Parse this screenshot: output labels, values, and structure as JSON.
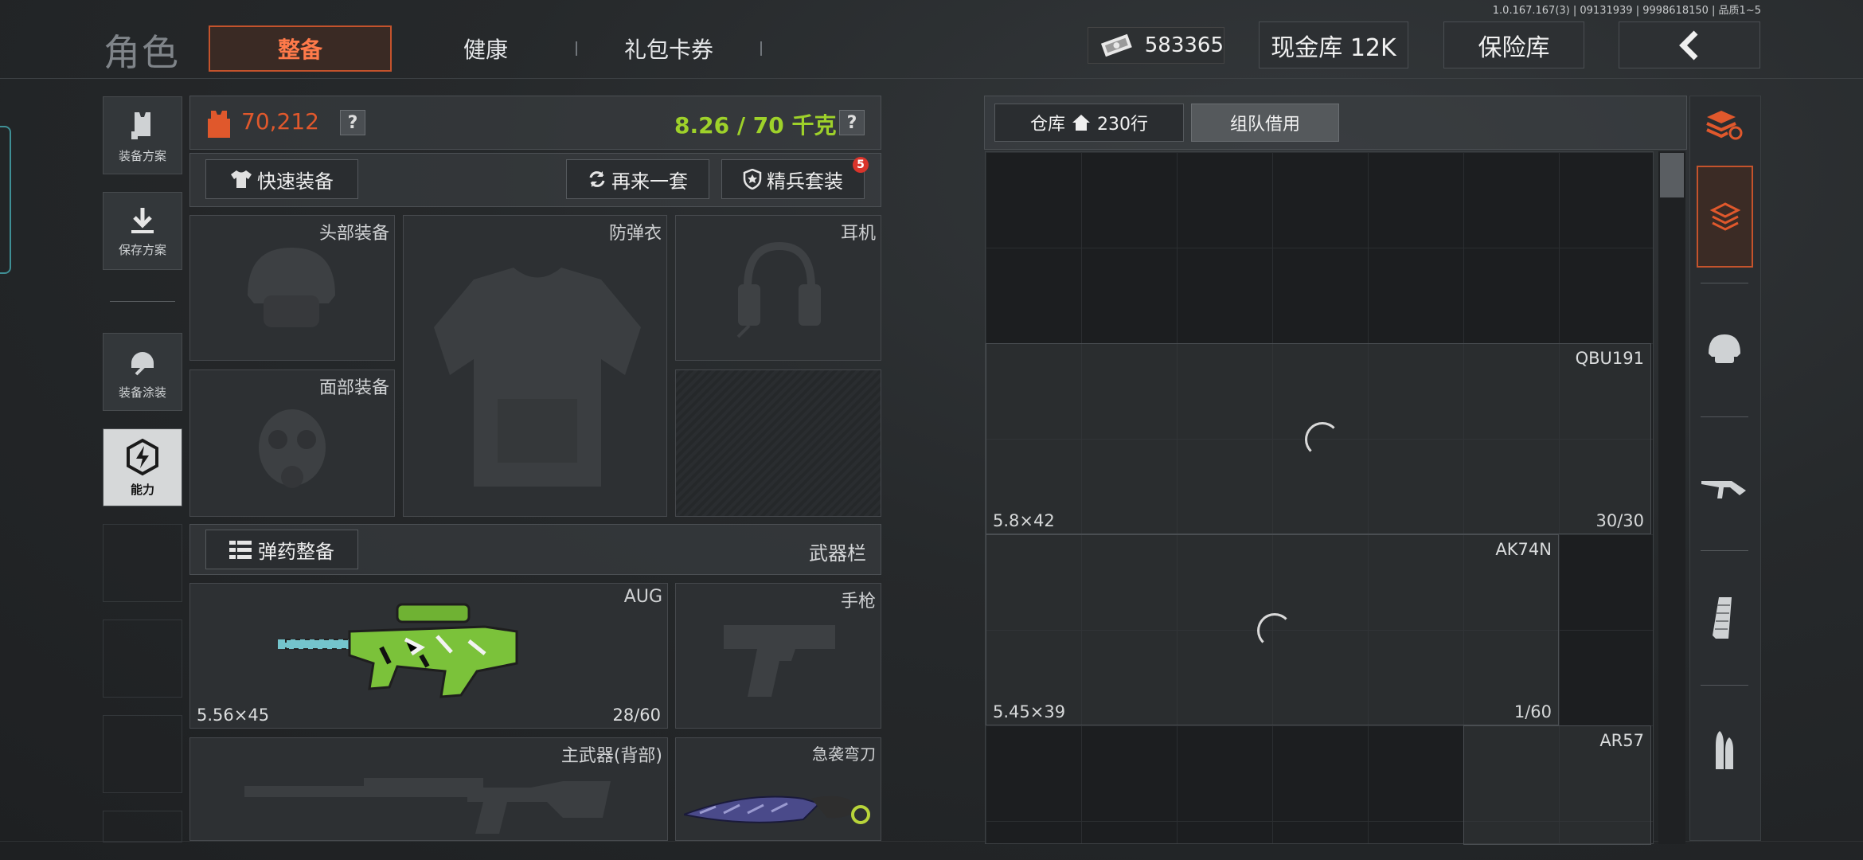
{
  "header": {
    "brand": "角色",
    "tabs": [
      "整备",
      "健康",
      "礼包卡券"
    ],
    "money_value": "583365",
    "cash_vault": "现金库 12K",
    "safe_vault": "保险库",
    "version": "1.0.167.167(3) | 09131939 | 9998618150 | 品质1~5"
  },
  "left_rail": {
    "items": [
      "装备方案",
      "保存方案",
      "装备涂装",
      "能力"
    ]
  },
  "equipment": {
    "value": "70,212",
    "weight": "8.26 / 70 千克",
    "quick_equip": "快速装备",
    "again": "再来一套",
    "elite_set": "精兵套装",
    "elite_badge": "5",
    "slots": {
      "head": "头部装备",
      "vest": "防弹衣",
      "earphone": "耳机",
      "face": "面部装备"
    },
    "ammo_btn": "弹药整备",
    "weapon_bar": "武器栏",
    "primary": {
      "name": "AUG",
      "caliber": "5.56×45",
      "ammo": "28/60"
    },
    "pistol": "手枪",
    "back_weapon": "主武器(背部)",
    "knife": "急袭弯刀"
  },
  "warehouse": {
    "tab_storage": "仓库",
    "rows": "230行",
    "tab_team": "组队借用",
    "items": [
      {
        "name": "QBU191",
        "caliber": "5.8×42",
        "ammo": "30/30"
      },
      {
        "name": "AK74N",
        "caliber": "5.45×39",
        "ammo": "1/60"
      },
      {
        "name": "AR57",
        "caliber": "",
        "ammo": ""
      }
    ]
  },
  "colors": {
    "accent": "#c4532c",
    "value_orange": "#e0582c",
    "weight_green": "#9ed12a",
    "badge_red": "#d9342b"
  }
}
